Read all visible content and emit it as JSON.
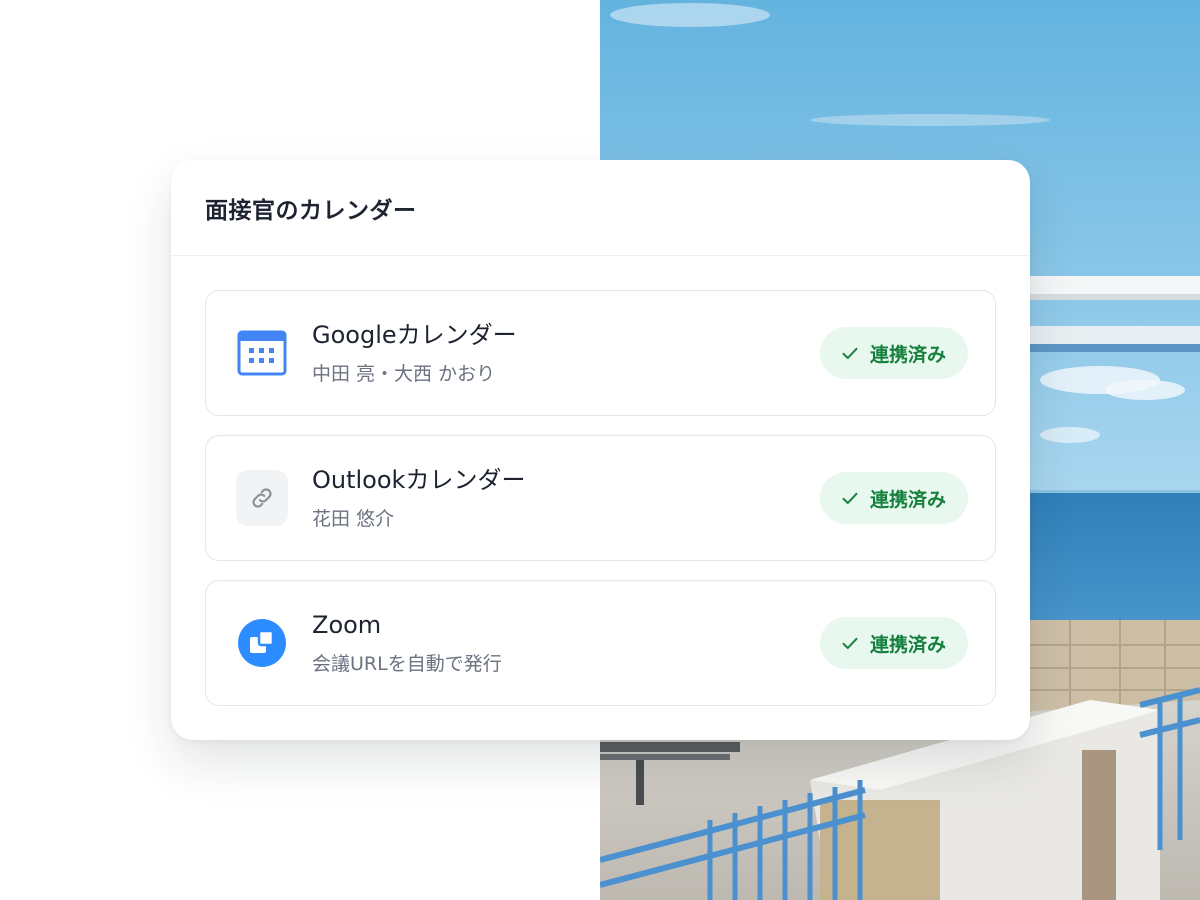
{
  "card": {
    "title": "面接官のカレンダー"
  },
  "integrations": [
    {
      "name": "Googleカレンダー",
      "detail": "中田 亮・大西 かおり",
      "icon": "calendar-icon",
      "status": "連携済み"
    },
    {
      "name": "Outlookカレンダー",
      "detail": "花田 悠介",
      "icon": "link-icon",
      "status": "連携済み"
    },
    {
      "name": "Zoom",
      "detail": "会議URLを自動で発行",
      "icon": "zoom-icon",
      "status": "連携済み"
    }
  ],
  "colors": {
    "badge_bg": "#e8f8ee",
    "badge_text": "#15803d",
    "google_blue": "#4285f4",
    "zoom_blue": "#2d8cff"
  }
}
